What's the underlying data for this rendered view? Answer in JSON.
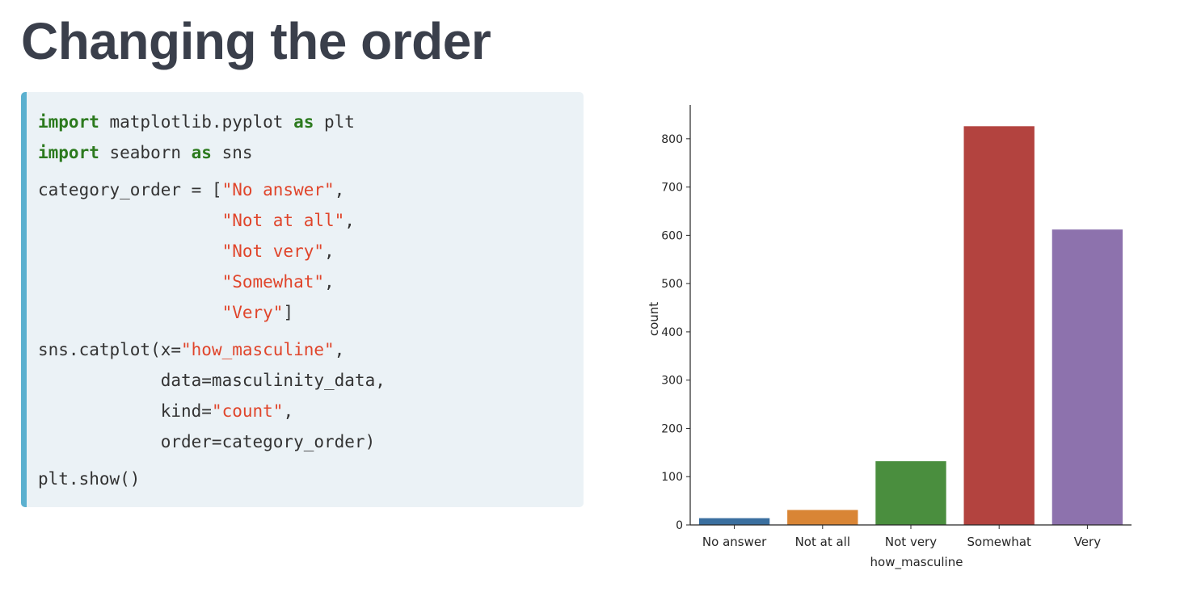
{
  "title": "Changing the order",
  "code": {
    "lines": [
      {
        "parts": [
          {
            "t": "import",
            "c": "kw"
          },
          {
            "t": " matplotlib.pyplot "
          },
          {
            "t": "as",
            "c": "kw"
          },
          {
            "t": " plt"
          }
        ]
      },
      {
        "parts": [
          {
            "t": "import",
            "c": "kw"
          },
          {
            "t": " seaborn "
          },
          {
            "t": "as",
            "c": "kw"
          },
          {
            "t": " sns"
          }
        ]
      },
      {
        "gap": true,
        "parts": [
          {
            "t": "category_order = ["
          },
          {
            "t": "\"No answer\"",
            "c": "str"
          },
          {
            "t": ","
          }
        ]
      },
      {
        "parts": [
          {
            "t": "                  "
          },
          {
            "t": "\"Not at all\"",
            "c": "str"
          },
          {
            "t": ","
          }
        ]
      },
      {
        "parts": [
          {
            "t": "                  "
          },
          {
            "t": "\"Not very\"",
            "c": "str"
          },
          {
            "t": ","
          }
        ]
      },
      {
        "parts": [
          {
            "t": "                  "
          },
          {
            "t": "\"Somewhat\"",
            "c": "str"
          },
          {
            "t": ","
          }
        ]
      },
      {
        "parts": [
          {
            "t": "                  "
          },
          {
            "t": "\"Very\"",
            "c": "str"
          },
          {
            "t": "]"
          }
        ]
      },
      {
        "gap": true,
        "parts": [
          {
            "t": "sns.catplot(x="
          },
          {
            "t": "\"how_masculine\"",
            "c": "str"
          },
          {
            "t": ","
          }
        ]
      },
      {
        "parts": [
          {
            "t": "            data=masculinity_data,"
          }
        ]
      },
      {
        "parts": [
          {
            "t": "            kind="
          },
          {
            "t": "\"count\"",
            "c": "str"
          },
          {
            "t": ","
          }
        ]
      },
      {
        "parts": [
          {
            "t": "            order=category_order)"
          }
        ]
      },
      {
        "gap": true,
        "parts": [
          {
            "t": "plt.show()"
          }
        ]
      }
    ]
  },
  "chart_data": {
    "type": "bar",
    "categories": [
      "No answer",
      "Not at all",
      "Not very",
      "Somewhat",
      "Very"
    ],
    "values": [
      14,
      31,
      132,
      826,
      612
    ],
    "colors": [
      "#3a6f9f",
      "#d98535",
      "#4a8e3e",
      "#b3433f",
      "#8d72ad"
    ],
    "xlabel": "how_masculine",
    "ylabel": "count",
    "ylim": [
      0,
      870
    ],
    "yticks": [
      0,
      100,
      200,
      300,
      400,
      500,
      600,
      700,
      800
    ],
    "grid": false,
    "legend": "none"
  }
}
